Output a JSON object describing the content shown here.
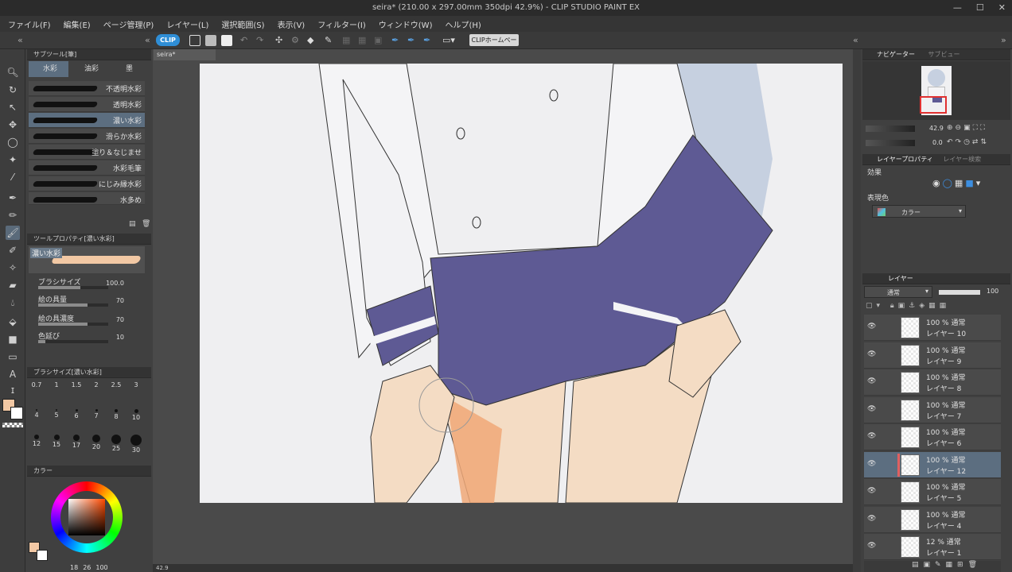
{
  "window": {
    "title": "seira* (210.00 x 297.00mm 350dpi 42.9%) - CLIP STUDIO PAINT EX"
  },
  "menu": [
    "ファイル(F)",
    "編集(E)",
    "ページ管理(P)",
    "レイヤー(L)",
    "選択範囲(S)",
    "表示(V)",
    "フィルター(I)",
    "ウィンドウ(W)",
    "ヘルプ(H)"
  ],
  "toolbar": {
    "clip_label": "CLIP",
    "home_label": "CLIPホームページ"
  },
  "subtool": {
    "header": "サブツール[筆]",
    "tabs": [
      "水彩",
      "油彩",
      "墨"
    ],
    "brushes": [
      {
        "label": "不透明水彩",
        "selected": false
      },
      {
        "label": "透明水彩",
        "selected": false
      },
      {
        "label": "濃い水彩",
        "selected": true
      },
      {
        "label": "滑らか水彩",
        "selected": false
      },
      {
        "label": "塗り＆なじませ",
        "selected": false
      },
      {
        "label": "水彩毛筆",
        "selected": false
      },
      {
        "label": "にじみ縁水彩",
        "selected": false
      },
      {
        "label": "水多め",
        "selected": false
      }
    ]
  },
  "toolprop": {
    "header": "ツールプロパティ[濃い水彩]",
    "brush_name": "濃い水彩",
    "rows": [
      {
        "label": "ブラシサイズ",
        "value": "100.0",
        "fill": 0.6
      },
      {
        "label": "絵の具量",
        "value": "70",
        "fill": 0.7
      },
      {
        "label": "絵の具濃度",
        "value": "70",
        "fill": 0.7
      },
      {
        "label": "色延び",
        "value": "10",
        "fill": 0.1
      }
    ]
  },
  "brushsize": {
    "header": "ブラシサイズ[濃い水彩]",
    "sizes": [
      "0.7",
      "1",
      "1.5",
      "2",
      "2.5",
      "3",
      "4",
      "5",
      "6",
      "7",
      "8",
      "10",
      "12",
      "15",
      "17",
      "20",
      "25",
      "30"
    ]
  },
  "color": {
    "header": "カラー",
    "main": "#f2c8a4",
    "sub": "#ffffff",
    "readout": [
      "18",
      "26",
      "100"
    ]
  },
  "document": {
    "tab": "seira*",
    "zoom": "42.9"
  },
  "navigator": {
    "tab": "ナビゲーター",
    "tab2": "サブビュー",
    "zoom": "42.9",
    "angle": "0.0"
  },
  "layerprop": {
    "tab": "レイヤープロパティ",
    "tab2": "レイヤー検索",
    "effect_label": "効果",
    "color_label": "表現色",
    "color_value": "カラー"
  },
  "layers": {
    "tab": "レイヤー",
    "blend": "通常",
    "opacity": "100",
    "items": [
      {
        "mode": "100 %  通常",
        "name": "レイヤー 10",
        "selected": false
      },
      {
        "mode": "100 %  通常",
        "name": "レイヤー 9",
        "selected": false
      },
      {
        "mode": "100 %  通常",
        "name": "レイヤー 8",
        "selected": false
      },
      {
        "mode": "100 %  通常",
        "name": "レイヤー 7",
        "selected": false
      },
      {
        "mode": "100 %  通常",
        "name": "レイヤー 6",
        "selected": false
      },
      {
        "mode": "100 %  通常",
        "name": "レイヤー 12",
        "selected": true
      },
      {
        "mode": "100 %  通常",
        "name": "レイヤー 5",
        "selected": false
      },
      {
        "mode": "100 %  通常",
        "name": "レイヤー 4",
        "selected": false
      },
      {
        "mode": "12 %  通常",
        "name": "レイヤー 1",
        "selected": false
      }
    ]
  },
  "colors": {
    "skirt": "#5e5a94",
    "skin": "#f4dcc4",
    "skin_shadow": "#f0a878",
    "shirt": "#f4f4f6",
    "hair": "#c6d0e0",
    "accent": "#2f8ed6"
  }
}
